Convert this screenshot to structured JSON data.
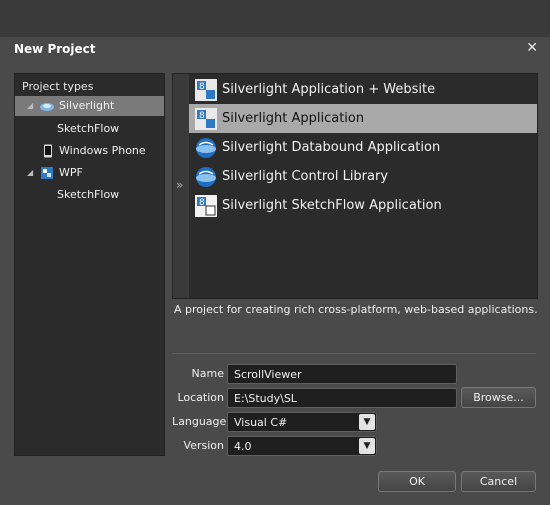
{
  "dialog": {
    "title": "New Project"
  },
  "project_types": {
    "header": "Project types",
    "items": [
      {
        "label": "Silverlight",
        "icon": "silverlight-icon",
        "expanded": true,
        "selected": true
      },
      {
        "label": "SketchFlow"
      },
      {
        "label": "Windows Phone",
        "icon": "phone-icon"
      },
      {
        "label": "WPF",
        "icon": "wpf-icon",
        "expanded": true
      },
      {
        "label": "SketchFlow"
      }
    ]
  },
  "templates": [
    {
      "label": "Silverlight Application + Website",
      "icon": "silverlight-app-icon"
    },
    {
      "label": "Silverlight Application",
      "icon": "silverlight-app-icon",
      "selected": true
    },
    {
      "label": "Silverlight Databound Application",
      "icon": "silverlight-globe-icon"
    },
    {
      "label": "Silverlight Control Library",
      "icon": "silverlight-globe-icon"
    },
    {
      "label": "Silverlight SketchFlow Application",
      "icon": "sketchflow-app-icon"
    }
  ],
  "description": "A project for creating rich cross-platform, web-based applications.",
  "form": {
    "name_label": "Name",
    "name_value": "ScrollViewer",
    "location_label": "Location",
    "location_value": "E:\\Study\\SL",
    "browse_label": "Browse...",
    "language_label": "Language",
    "language_value": "Visual C#",
    "version_label": "Version",
    "version_value": "4.0"
  },
  "buttons": {
    "ok": "OK",
    "cancel": "Cancel"
  },
  "colors": {
    "background": "#4a4a4a",
    "panel": "#2b2b2b",
    "selection": "#a9a9a9",
    "accent": "#1f6fc0"
  }
}
